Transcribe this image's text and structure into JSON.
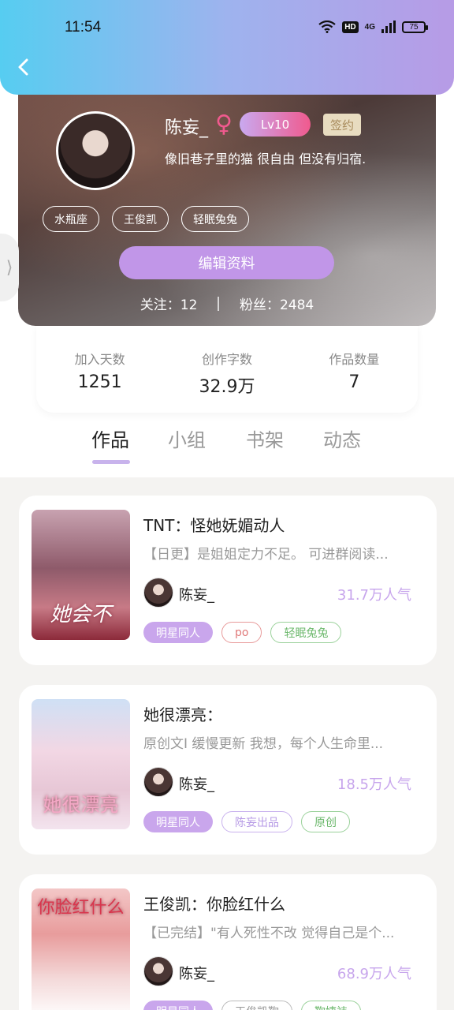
{
  "status_bar": {
    "time": "11:54",
    "hd": "HD",
    "network": "4G",
    "battery": "75"
  },
  "profile": {
    "username": "陈妄_",
    "gender_symbol": "♀",
    "level": "Lv10",
    "signed": "签约",
    "bio": "像旧巷子里的猫 很自由 但没有归宿.",
    "tags": [
      "水瓶座",
      "王俊凯",
      "轻眠兔兔"
    ],
    "edit_button": "编辑资料",
    "following_label": "关注：",
    "following_count": "12",
    "fans_label": "粉丝：",
    "fans_count": "2484"
  },
  "stats": [
    {
      "label": "加入天数",
      "value": "1251"
    },
    {
      "label": "创作字数",
      "value": "32.9万"
    },
    {
      "label": "作品数量",
      "value": "7"
    }
  ],
  "tabs": [
    "作品",
    "小组",
    "书架",
    "动态"
  ],
  "active_tab": "作品",
  "works": [
    {
      "title": "TNT：怪她妩媚动人",
      "desc": "【日更】是姐姐定力不足。 可进群阅读...",
      "author": "陈妄_",
      "popularity": "31.7万人气",
      "tags": [
        {
          "text": "明星同人",
          "style": "purple"
        },
        {
          "text": "po",
          "style": "red"
        },
        {
          "text": "轻眠兔兔",
          "style": "green"
        }
      ]
    },
    {
      "title": "她很漂亮：",
      "desc": "原创文I 缓慢更新 我想，每个人生命里...",
      "author": "陈妄_",
      "popularity": "18.5万人气",
      "tags": [
        {
          "text": "明星同人",
          "style": "purple"
        },
        {
          "text": "陈妄出品",
          "style": "lav"
        },
        {
          "text": "原创",
          "style": "green"
        }
      ]
    },
    {
      "title": "王俊凯：你脸红什么",
      "desc": "【已完结】\"有人死性不改 觉得自己是个...",
      "author": "陈妄_",
      "popularity": "68.9万人气",
      "tags": [
        {
          "text": "明星同人",
          "style": "purple"
        },
        {
          "text": "王俊凯鞠",
          "style": "gray"
        },
        {
          "text": "鞠婕祎",
          "style": "green"
        }
      ]
    }
  ],
  "colors": {
    "accent": "#c196e8",
    "popularity": "#c7a5ec",
    "female": "#f05a8e"
  }
}
